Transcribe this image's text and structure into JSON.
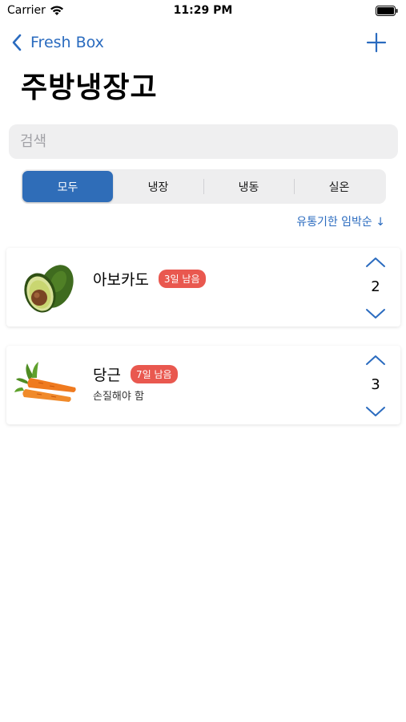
{
  "status_bar": {
    "carrier": "Carrier",
    "time": "11:29 PM"
  },
  "nav": {
    "back_label": "Fresh Box"
  },
  "page_title": "주방냉장고",
  "search": {
    "placeholder": "검색",
    "value": ""
  },
  "segments": [
    {
      "label": "모두",
      "selected": true
    },
    {
      "label": "냉장",
      "selected": false
    },
    {
      "label": "냉동",
      "selected": false
    },
    {
      "label": "실온",
      "selected": false
    }
  ],
  "sort_label": "유통기한 임박순 ↓",
  "items": [
    {
      "name": "아보카도",
      "badge": "3일 남음",
      "note": "",
      "quantity": "2",
      "image": "avocado"
    },
    {
      "name": "당근",
      "badge": "7일 남음",
      "note": "손질해야 함",
      "quantity": "3",
      "image": "carrot"
    }
  ],
  "colors": {
    "accent": "#2a6bbf",
    "segment_active": "#2f6db8",
    "badge": "#e9584f",
    "search_bg": "#efeff0"
  }
}
